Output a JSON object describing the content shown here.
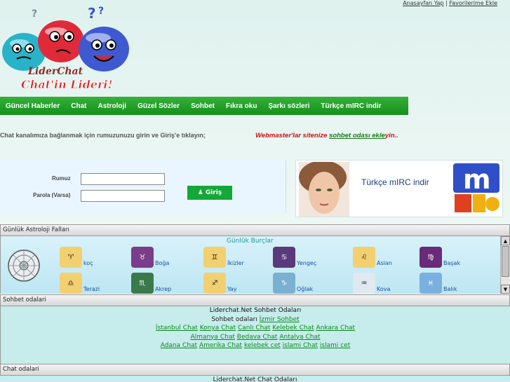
{
  "header": {
    "top_links": [
      "Anasayfan Yap",
      "Favorilerime Ekle"
    ],
    "logo_text_1": "LiderChat",
    "logo_text_2": "Chat'in Lideri!"
  },
  "nav": {
    "items": [
      "Güncel Haberler",
      "Chat",
      "Astroloji",
      "Güzel Sözler",
      "Sohbet",
      "Fıkra oku",
      "Şarkı sözleri",
      "Türkçe mIRC indir"
    ]
  },
  "instruction": "Chat kanalımıza bağlanmak için rumuzunuzu girin ve Giriş'e tıklayın;",
  "webmaster": {
    "prefix": "Webmaster'lar sitenize ",
    "link": "sohbet odası ekle",
    "suffix": "yin.."
  },
  "login": {
    "nick_label": "Rumuz",
    "pass_label": "Parola (Varsa)",
    "nick_value": "",
    "pass_value": "",
    "button_label": "Giriş"
  },
  "banner": {
    "text": "Türkçe mIRC indir"
  },
  "astrology": {
    "section_title": "Günlük Astroloji Falları",
    "title": "Günlük Burçlar",
    "signs": [
      "koç",
      "Boğa",
      "İkizler",
      "Yengeç",
      "Aslan",
      "Başak",
      "Terazi",
      "Akrep",
      "Yay",
      "Oğlak",
      "Kova",
      "Balık"
    ]
  },
  "rooms": {
    "section_title": "Sohbet odalari",
    "title": "Liderchat.Net Sohbet Odaları",
    "line2_prefix": "Sohbet odaları",
    "line2_link": "İzmir Sohbet",
    "line3": [
      "İstanbul Chat",
      "Konya Chat",
      "Canlı Chat",
      "Kelebek Chat",
      "Ankara Chat"
    ],
    "line4": [
      "Almanya Chat",
      "Bedava Chat",
      "Antalya Chat"
    ],
    "line5": [
      "Adana Chat",
      "Amerika Chat",
      "kelebek cet",
      "islami Chat",
      "islami cet"
    ]
  },
  "chat": {
    "section_title": "Chat odalari",
    "title": "Liderchat.Net Chat Odaları"
  },
  "colors": {
    "nav_green": "#1aa023",
    "link_green": "#0a8a1a",
    "webmaster_red": "#cc1111",
    "astro_bg": "#c9ebf6",
    "rooms_bg": "#c6ecec"
  }
}
